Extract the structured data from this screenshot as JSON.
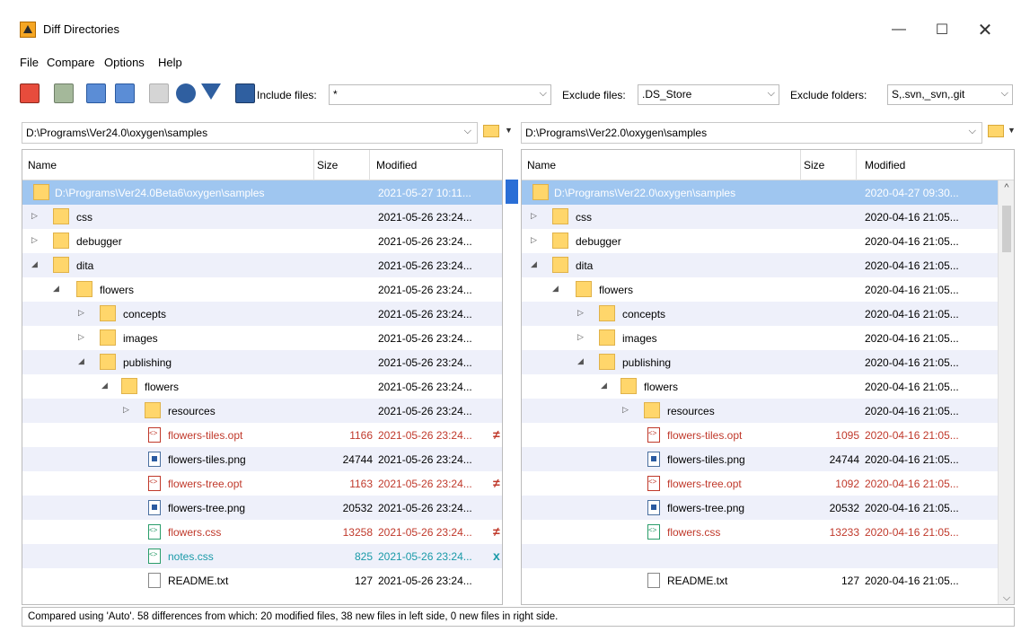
{
  "window": {
    "title": "Diff Directories"
  },
  "menu": [
    "File",
    "Compare",
    "Options",
    "Help"
  ],
  "toolbar": {
    "include_label": "Include files:",
    "include_value": "*",
    "exclude_label": "Exclude files:",
    "exclude_value": ".DS_Store",
    "exclude_folders_label": "Exclude folders:",
    "exclude_folders_value": "S,.svn,_svn,.git"
  },
  "left": {
    "path": "D:\\Programs\\Ver24.0\\oxygen\\samples"
  },
  "right": {
    "path": "D:\\Programs\\Ver22.0\\oxygen\\samples"
  },
  "columns": {
    "name": "Name",
    "size": "Size",
    "modified": "Modified"
  },
  "left_rows": [
    {
      "name": "D:\\Programs\\Ver24.0Beta6\\oxygen\\samples",
      "size": "",
      "modified": "2021-05-27  10:11...",
      "mark": ""
    },
    {
      "name": "css",
      "size": "",
      "modified": "2021-05-26  23:24...",
      "mark": ""
    },
    {
      "name": "debugger",
      "size": "",
      "modified": "2021-05-26  23:24...",
      "mark": ""
    },
    {
      "name": "dita",
      "size": "",
      "modified": "2021-05-26  23:24...",
      "mark": ""
    },
    {
      "name": "flowers",
      "size": "",
      "modified": "2021-05-26  23:24...",
      "mark": ""
    },
    {
      "name": "concepts",
      "size": "",
      "modified": "2021-05-26  23:24...",
      "mark": ""
    },
    {
      "name": "images",
      "size": "",
      "modified": "2021-05-26  23:24...",
      "mark": ""
    },
    {
      "name": "publishing",
      "size": "",
      "modified": "2021-05-26  23:24...",
      "mark": ""
    },
    {
      "name": "flowers",
      "size": "",
      "modified": "2021-05-26  23:24...",
      "mark": ""
    },
    {
      "name": "resources",
      "size": "",
      "modified": "2021-05-26  23:24...",
      "mark": ""
    },
    {
      "name": "flowers-tiles.opt",
      "size": "1166",
      "modified": "2021-05-26  23:24...",
      "mark": "≠"
    },
    {
      "name": "flowers-tiles.png",
      "size": "24744",
      "modified": "2021-05-26  23:24...",
      "mark": ""
    },
    {
      "name": "flowers-tree.opt",
      "size": "1163",
      "modified": "2021-05-26  23:24...",
      "mark": "≠"
    },
    {
      "name": "flowers-tree.png",
      "size": "20532",
      "modified": "2021-05-26  23:24...",
      "mark": ""
    },
    {
      "name": "flowers.css",
      "size": "13258",
      "modified": "2021-05-26  23:24...",
      "mark": "≠"
    },
    {
      "name": "notes.css",
      "size": "825",
      "modified": "2021-05-26  23:24...",
      "mark": "x"
    },
    {
      "name": "README.txt",
      "size": "127",
      "modified": "2021-05-26  23:24...",
      "mark": ""
    }
  ],
  "right_rows": [
    {
      "name": "D:\\Programs\\Ver22.0\\oxygen\\samples",
      "size": "",
      "modified": "2020-04-27  09:30..."
    },
    {
      "name": "css",
      "size": "",
      "modified": "2020-04-16  21:05..."
    },
    {
      "name": "debugger",
      "size": "",
      "modified": "2020-04-16  21:05..."
    },
    {
      "name": "dita",
      "size": "",
      "modified": "2020-04-16  21:05..."
    },
    {
      "name": "flowers",
      "size": "",
      "modified": "2020-04-16  21:05..."
    },
    {
      "name": "concepts",
      "size": "",
      "modified": "2020-04-16  21:05..."
    },
    {
      "name": "images",
      "size": "",
      "modified": "2020-04-16  21:05..."
    },
    {
      "name": "publishing",
      "size": "",
      "modified": "2020-04-16  21:05..."
    },
    {
      "name": "flowers",
      "size": "",
      "modified": "2020-04-16  21:05..."
    },
    {
      "name": "resources",
      "size": "",
      "modified": "2020-04-16  21:05..."
    },
    {
      "name": "flowers-tiles.opt",
      "size": "1095",
      "modified": "2020-04-16  21:05..."
    },
    {
      "name": "flowers-tiles.png",
      "size": "24744",
      "modified": "2020-04-16  21:05..."
    },
    {
      "name": "flowers-tree.opt",
      "size": "1092",
      "modified": "2020-04-16  21:05..."
    },
    {
      "name": "flowers-tree.png",
      "size": "20532",
      "modified": "2020-04-16  21:05..."
    },
    {
      "name": "flowers.css",
      "size": "13233",
      "modified": "2020-04-16  21:05..."
    },
    {
      "name": "",
      "size": "",
      "modified": ""
    },
    {
      "name": "README.txt",
      "size": "127",
      "modified": "2020-04-16  21:05..."
    }
  ],
  "status": "Compared using 'Auto'. 58 differences from which: 20 modified files, 38 new files in left side, 0 new files in right side."
}
